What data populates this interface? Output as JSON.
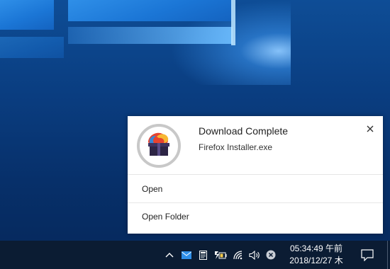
{
  "notification": {
    "title": "Download Complete",
    "filename": "Firefox Installer.exe",
    "actions": [
      {
        "label": "Open"
      },
      {
        "label": "Open Folder"
      }
    ],
    "close_icon": "close-icon",
    "app_icon": "firefox-download-icon"
  },
  "taskbar": {
    "time": "05:34:49 午前",
    "date": "2018/12/27 木",
    "tray_icons": [
      "chevron-up-icon",
      "mail-icon",
      "notes-icon",
      "battery-icon",
      "wifi-icon",
      "speaker-icon",
      "close-circle-icon",
      "action-center-icon"
    ]
  },
  "colors": {
    "taskbar_bg": "#0b1c33",
    "toast_bg": "#ffffff",
    "desktop_blue": "#0e4d96",
    "mail_blue": "#2f8fe8"
  }
}
